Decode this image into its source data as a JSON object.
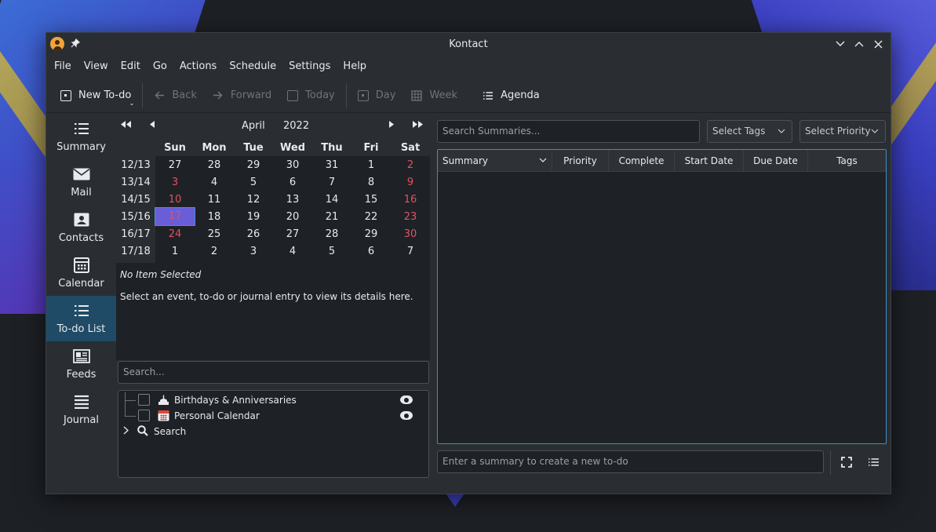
{
  "window": {
    "title": "Kontact"
  },
  "menu": [
    "File",
    "View",
    "Edit",
    "Go",
    "Actions",
    "Schedule",
    "Settings",
    "Help"
  ],
  "toolbar": {
    "new_todo": "New To-do",
    "back": "Back",
    "forward": "Forward",
    "today": "Today",
    "day": "Day",
    "week": "Week",
    "agenda": "Agenda"
  },
  "sidebar": {
    "items": [
      {
        "label": "Summary",
        "icon": "list-icon"
      },
      {
        "label": "Mail",
        "icon": "mail-icon"
      },
      {
        "label": "Contacts",
        "icon": "contact-card-icon"
      },
      {
        "label": "Calendar",
        "icon": "calendar-grid-icon"
      },
      {
        "label": "To-do List",
        "icon": "todo-list-icon",
        "active": true
      },
      {
        "label": "Feeds",
        "icon": "feeds-icon"
      },
      {
        "label": "Journal",
        "icon": "journal-icon"
      }
    ]
  },
  "calendar": {
    "month": "April",
    "year": "2022",
    "weekdays": [
      "Sun",
      "Mon",
      "Tue",
      "Wed",
      "Thu",
      "Fri",
      "Sat"
    ],
    "weeks": [
      {
        "wk": "12/13",
        "days": [
          "27",
          "28",
          "29",
          "30",
          "31",
          "1",
          "2"
        ]
      },
      {
        "wk": "13/14",
        "days": [
          "3",
          "4",
          "5",
          "6",
          "7",
          "8",
          "9"
        ]
      },
      {
        "wk": "14/15",
        "days": [
          "10",
          "11",
          "12",
          "13",
          "14",
          "15",
          "16"
        ]
      },
      {
        "wk": "15/16",
        "days": [
          "17",
          "18",
          "19",
          "20",
          "21",
          "22",
          "23"
        ]
      },
      {
        "wk": "16/17",
        "days": [
          "24",
          "25",
          "26",
          "27",
          "28",
          "29",
          "30"
        ]
      },
      {
        "wk": "17/18",
        "days": [
          "1",
          "2",
          "3",
          "4",
          "5",
          "6",
          "7"
        ]
      }
    ],
    "today": "17",
    "weekend_color": "#e05260",
    "today_color": "#6a5ed8"
  },
  "detail": {
    "no_item": "No Item Selected",
    "hint": "Select an event, to-do or journal entry to view its details here."
  },
  "left_search": {
    "placeholder": "Search..."
  },
  "calendars": [
    {
      "label": "Birthdays & Anniversaries",
      "icon": "cake-icon"
    },
    {
      "label": "Personal Calendar",
      "icon": "calendar-icon"
    }
  ],
  "search_node": {
    "label": "Search"
  },
  "right": {
    "search_placeholder": "Search Summaries...",
    "select_tags": "Select Tags",
    "select_priority": "Select Priority",
    "columns": [
      "Summary",
      "Priority",
      "Complete",
      "Start Date",
      "Due Date",
      "Tags"
    ],
    "quick_add_placeholder": "Enter a summary to create a new to-do"
  },
  "colors": {
    "accent": "#3d8fc4",
    "active_sidebar": "#1f4b66"
  }
}
